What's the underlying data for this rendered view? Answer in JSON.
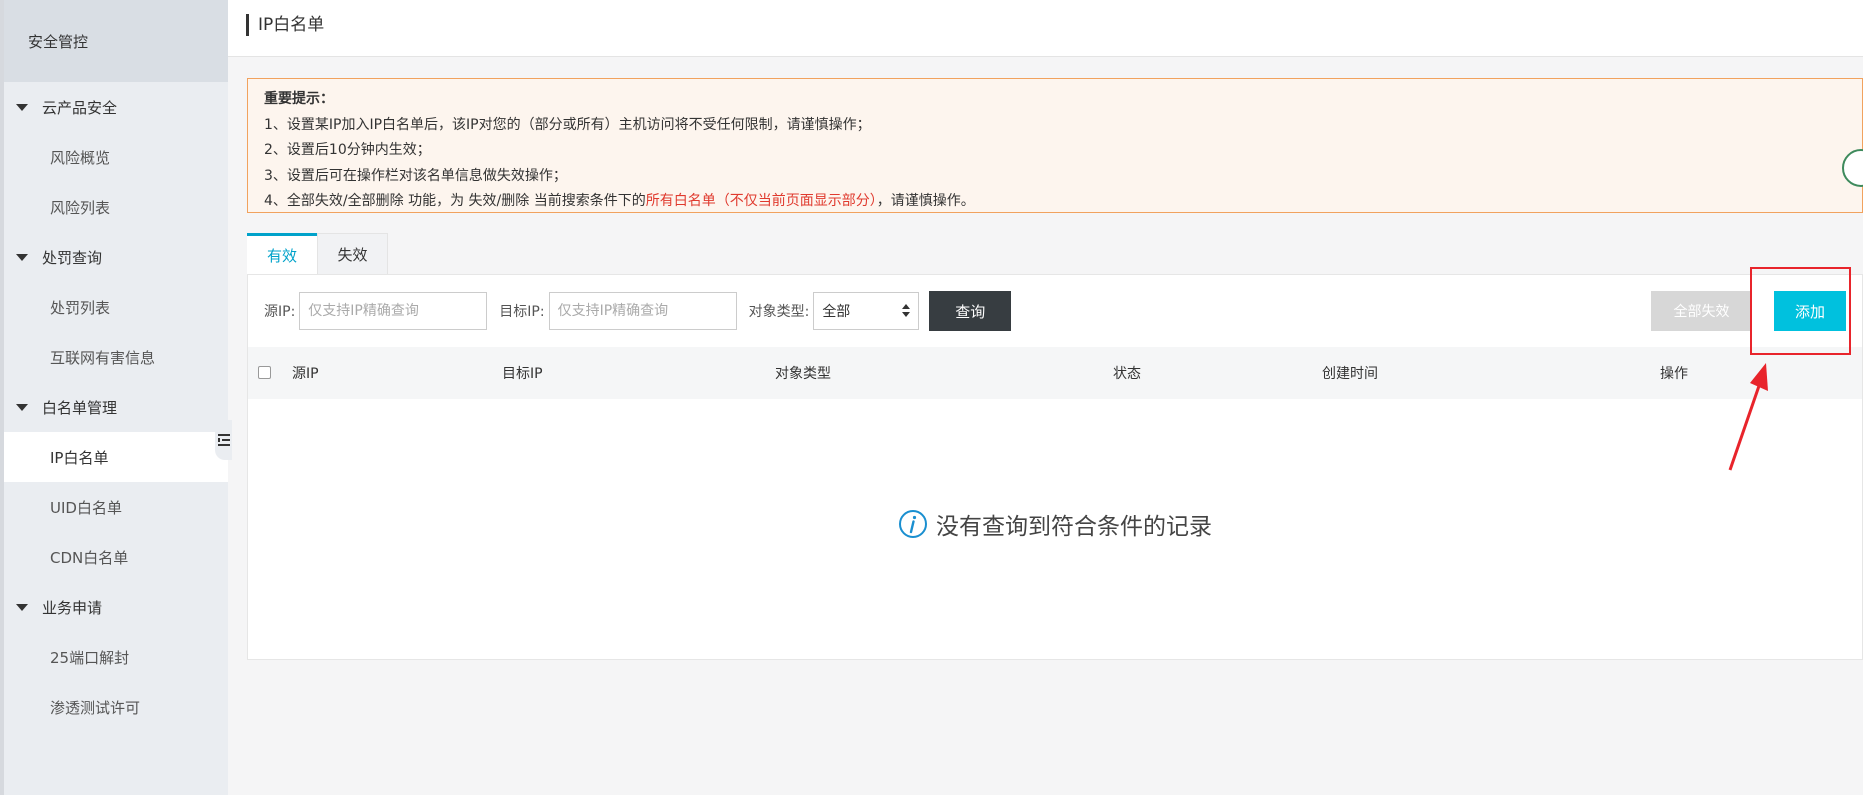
{
  "sidebar": {
    "header": "安全管控",
    "groups": [
      {
        "label": "云产品安全",
        "items": [
          "风险概览",
          "风险列表"
        ]
      },
      {
        "label": "处罚查询",
        "items": [
          "处罚列表",
          "互联网有害信息"
        ]
      },
      {
        "label": "白名单管理",
        "items": [
          "IP白名单",
          "UID白名单",
          "CDN白名单"
        ],
        "active": "IP白名单"
      },
      {
        "label": "业务申请",
        "items": [
          "25端口解封",
          "渗透测试许可"
        ]
      }
    ]
  },
  "header": {
    "title": "IP白名单"
  },
  "notice": {
    "title": "重要提示：",
    "line1": "1、设置某IP加入IP白名单后，该IP对您的（部分或所有）主机访问将不受任何限制，请谨慎操作；",
    "line2": "2、设置后10分钟内生效；",
    "line3": "3、设置后可在操作栏对该名单信息做失效操作；",
    "line4_pre": "4、全部失效/全部删除 功能，为 失效/删除 当前搜索条件下的",
    "line4_red": "所有白名单（不仅当前页面显示部分）",
    "line4_post": "，请谨慎操作。"
  },
  "tabs": [
    {
      "label": "有效",
      "active": true
    },
    {
      "label": "失效",
      "active": false
    }
  ],
  "filter": {
    "source_ip_label": "源IP:",
    "source_ip_placeholder": "仅支持IP精确查询",
    "target_ip_label": "目标IP:",
    "target_ip_placeholder": "仅支持IP精确查询",
    "object_type_label": "对象类型:",
    "object_type_value": "全部",
    "query_button": "查询",
    "disable_all_button": "全部失效",
    "add_button": "添加"
  },
  "table": {
    "columns": [
      "源IP",
      "目标IP",
      "对象类型",
      "状态",
      "创建时间",
      "操作"
    ],
    "rows": [],
    "empty_text": "没有查询到符合条件的记录"
  },
  "colors": {
    "accent": "#00a2ca",
    "add_button": "#00c1de",
    "query_button": "#373d41",
    "annotation": "#e8242b",
    "notice_border": "#f1a25e",
    "notice_bg": "#fdf5ee"
  }
}
